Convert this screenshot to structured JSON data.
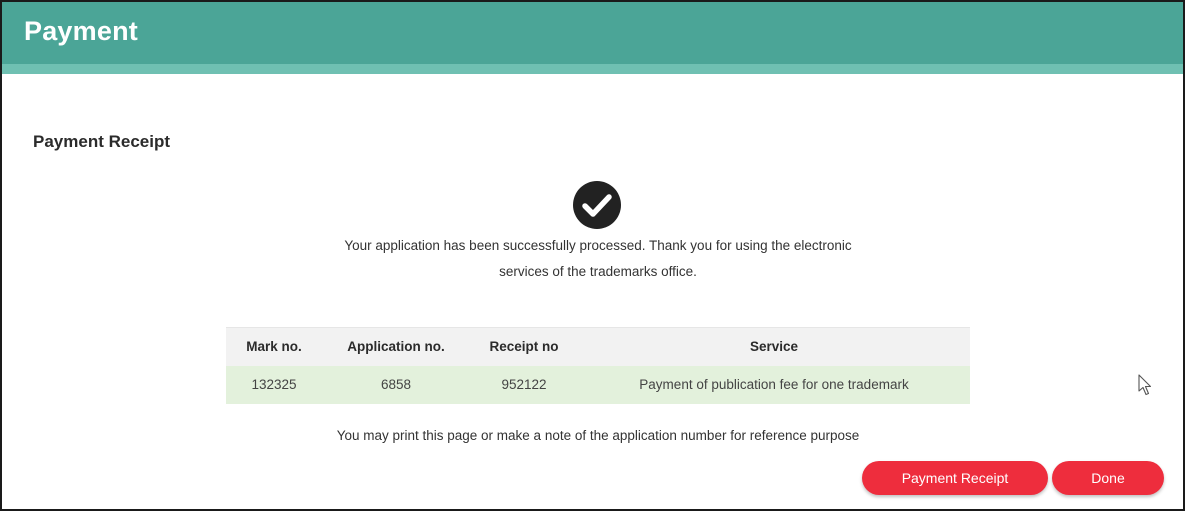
{
  "header": {
    "title": "Payment"
  },
  "section": {
    "title": "Payment Receipt"
  },
  "success": {
    "icon": "check-circle-icon",
    "message_line1": "Your application has been successfully processed. Thank you for using the electronic",
    "message_line2": "services of the trademarks office."
  },
  "table": {
    "headers": [
      "Mark no.",
      "Application no.",
      "Receipt no",
      "Service"
    ],
    "rows": [
      [
        "132325",
        "6858",
        "952122",
        "Payment of publication fee for one trademark"
      ]
    ]
  },
  "note": "You may print this page or make a note of the application number for reference purpose",
  "buttons": {
    "receipt_label": "Payment Receipt",
    "done_label": "Done"
  },
  "colors": {
    "header": "#4ba597",
    "header_strip": "#6fc0b2",
    "button": "#ee2d3d",
    "row_highlight": "#e3f1dc"
  }
}
